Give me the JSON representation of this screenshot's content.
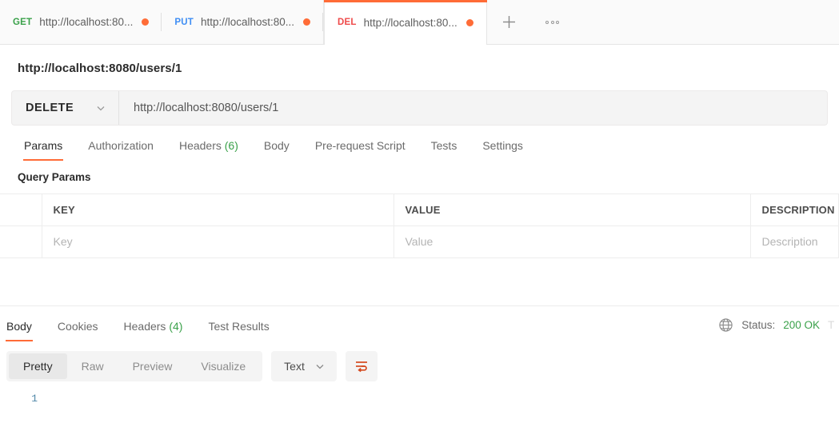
{
  "tabbar": {
    "tabs": [
      {
        "method": "GET",
        "method_class": "m-get",
        "url": "http://localhost:80...",
        "dot": "unsaved-dot",
        "active": false
      },
      {
        "method": "PUT",
        "method_class": "m-put",
        "url": "http://localhost:80...",
        "dot": "unsaved-dot",
        "active": false
      },
      {
        "method": "DEL",
        "method_class": "m-del",
        "url": "http://localhost:80...",
        "dot": "unsaved-dot",
        "active": true
      }
    ],
    "new_tab_label": "+",
    "new_tab_icon": "plus-icon",
    "more_icon": "ellipsis-icon"
  },
  "request": {
    "title": "http://localhost:8080/users/1",
    "method": "DELETE",
    "method_chevron_icon": "chevron-down-icon",
    "url": "http://localhost:8080/users/1",
    "url_placeholder": "Enter request URL",
    "tabs": [
      {
        "label": "Params",
        "count": "",
        "active": true
      },
      {
        "label": "Authorization",
        "count": "",
        "active": false
      },
      {
        "label": "Headers",
        "count": "(6)",
        "active": false
      },
      {
        "label": "Body",
        "count": "",
        "active": false
      },
      {
        "label": "Pre-request Script",
        "count": "",
        "active": false
      },
      {
        "label": "Tests",
        "count": "",
        "active": false
      },
      {
        "label": "Settings",
        "count": "",
        "active": false
      }
    ]
  },
  "query_params": {
    "section_title": "Query Params",
    "columns": [
      "",
      "KEY",
      "VALUE",
      "DESCRIPTION"
    ],
    "rows": [
      {
        "key": "Key",
        "value": "Value",
        "description": "Description"
      }
    ]
  },
  "response": {
    "tabs": [
      {
        "label": "Body",
        "count": "",
        "active": true
      },
      {
        "label": "Cookies",
        "count": "",
        "active": false
      },
      {
        "label": "Headers",
        "count": "(4)",
        "active": false
      },
      {
        "label": "Test Results",
        "count": "",
        "active": false
      }
    ],
    "globe_icon": "globe-icon",
    "status_label": "Status:",
    "status_value": "200 OK",
    "time_label_truncated": "T",
    "format_tabs": [
      {
        "label": "Pretty",
        "active": true
      },
      {
        "label": "Raw",
        "active": false
      },
      {
        "label": "Preview",
        "active": false
      },
      {
        "label": "Visualize",
        "active": false
      }
    ],
    "content_type": "Text",
    "content_type_chevron_icon": "chevron-down-icon",
    "wrap_icon": "word-wrap-icon",
    "body_lines": [
      {
        "number": "1",
        "text": ""
      }
    ]
  },
  "colors": {
    "accent": "#ff6c37",
    "get": "#3aa14a",
    "put": "#3f8ef4",
    "del": "#ef4b4b",
    "status_ok": "#3aa14a",
    "linenum": "#4f87a8"
  }
}
